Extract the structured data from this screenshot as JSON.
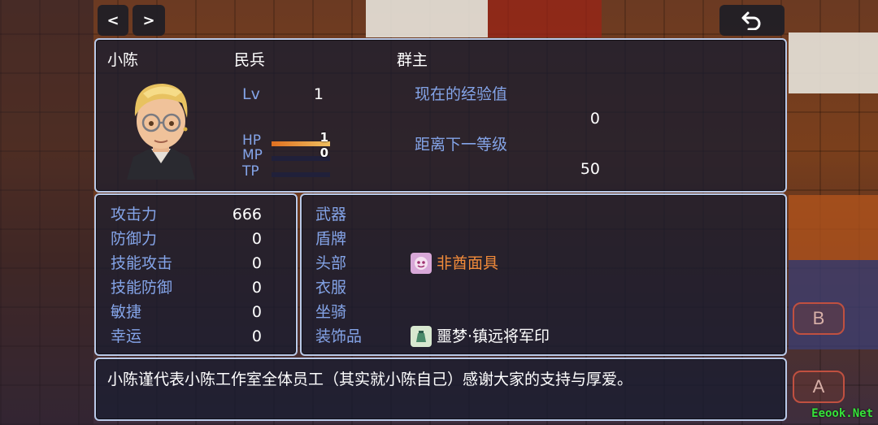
{
  "nav": {
    "prev_label": "<",
    "next_label": ">",
    "back_icon": "return-arrow-icon"
  },
  "status": {
    "name": "小陈",
    "class": "民兵",
    "nickname": "群主",
    "level_label": "Lv",
    "level": "1",
    "hp_label": "HP",
    "hp_value": "1",
    "hp_rate": 1.0,
    "mp_label": "MP",
    "mp_value": "0",
    "mp_rate": 0.0,
    "tp_label": "TP",
    "tp_rate": 0.0,
    "exp_label": "现在的经验值",
    "exp_value": "0",
    "next_label": "距离下一等级",
    "next_value": "50"
  },
  "params": [
    {
      "label": "攻击力",
      "value": "666"
    },
    {
      "label": "防御力",
      "value": "0"
    },
    {
      "label": "技能攻击",
      "value": "0"
    },
    {
      "label": "技能防御",
      "value": "0"
    },
    {
      "label": "敏捷",
      "value": "0"
    },
    {
      "label": "幸运",
      "value": "0"
    }
  ],
  "equips": [
    {
      "slot": "武器",
      "item": "",
      "icon": ""
    },
    {
      "slot": "盾牌",
      "item": "",
      "icon": ""
    },
    {
      "slot": "头部",
      "item": "非酋面具",
      "icon": "mask-icon"
    },
    {
      "slot": "衣服",
      "item": "",
      "icon": ""
    },
    {
      "slot": "坐骑",
      "item": "",
      "icon": ""
    },
    {
      "slot": "装饰品",
      "item": "噩梦·镇远将军印",
      "icon": "seal-bag-icon"
    }
  ],
  "description": "小陈谨代表小陈工作室全体员工（其实就小陈自己）感谢大家的支持与厚爱。",
  "pad": {
    "b_label": "B",
    "a_label": "A"
  },
  "watermark": "Eeook.Net",
  "colors": {
    "window_border": "#b9c9e8",
    "system_text": "#84a4e8",
    "hp_gauge": "#f0a030",
    "mp_gauge": "#3050c0",
    "tp_gauge": "#203060",
    "rare_item": "#f08a3a",
    "watermark": "#36e43a"
  }
}
